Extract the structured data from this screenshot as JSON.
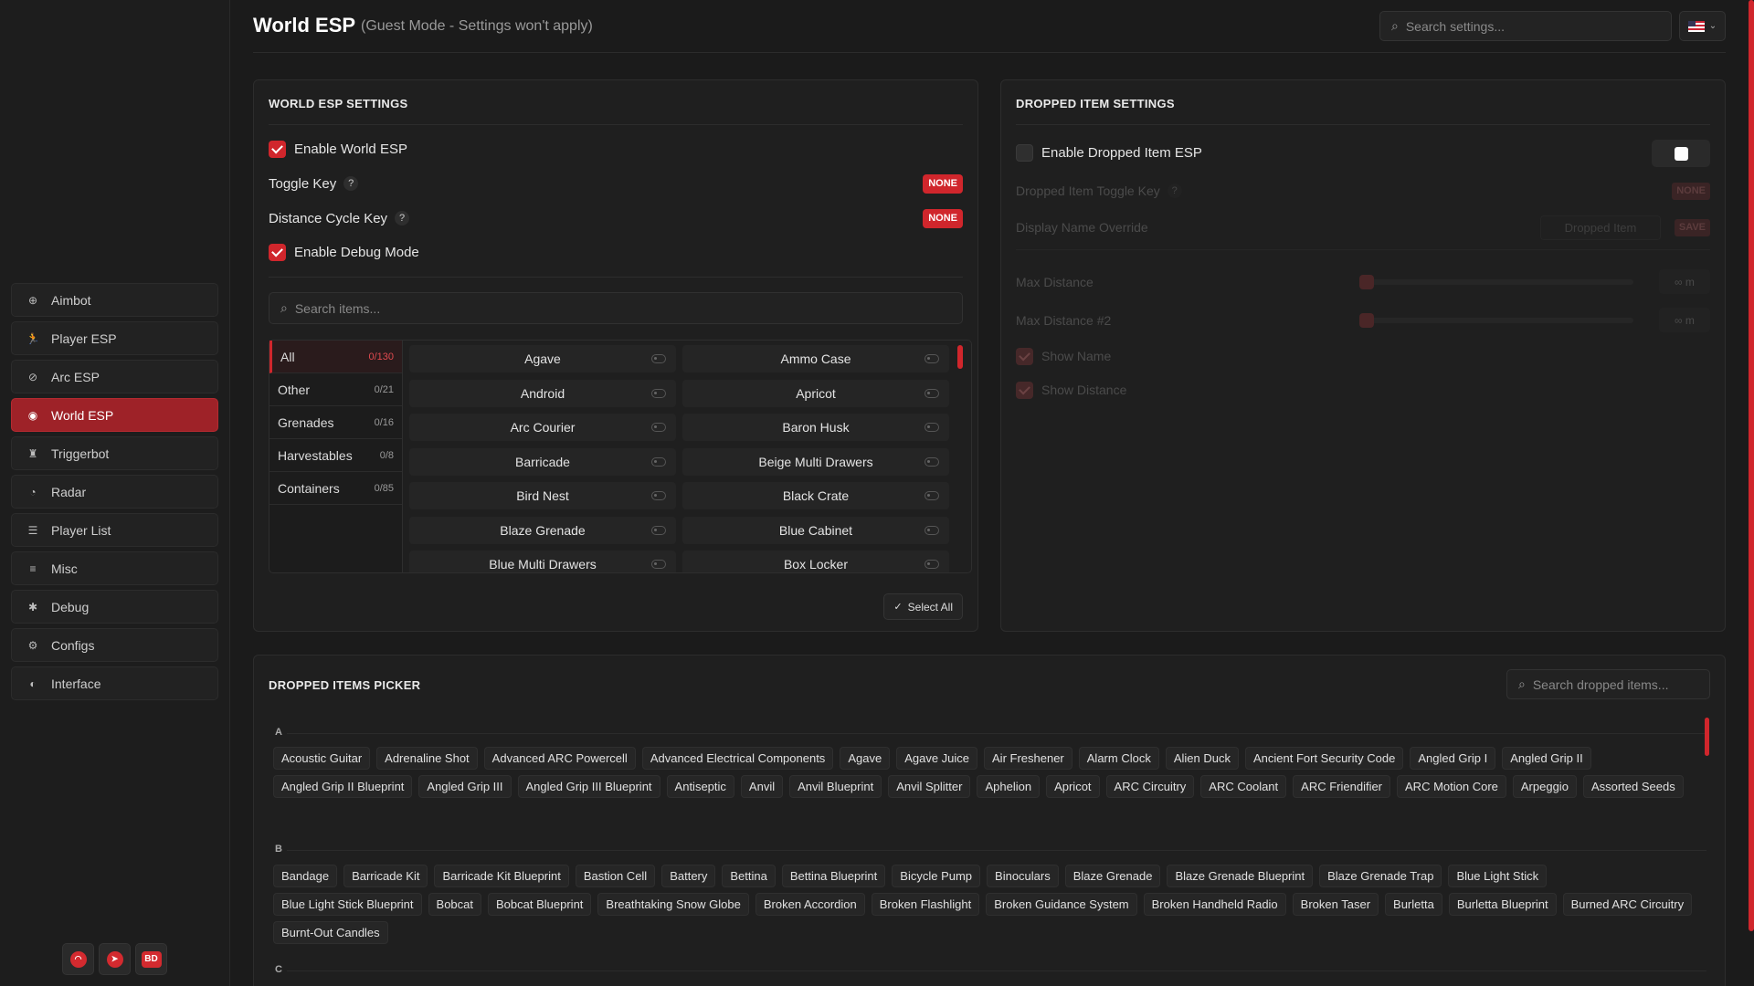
{
  "sidebar": {
    "items": [
      {
        "label": "Aimbot",
        "icon": "crosshair-icon",
        "glyph": "⊕"
      },
      {
        "label": "Player ESP",
        "icon": "running-person-icon",
        "glyph": "🏃"
      },
      {
        "label": "Arc ESP",
        "icon": "eye-slash-icon",
        "glyph": "⊘"
      },
      {
        "label": "World ESP",
        "icon": "globe-icon",
        "glyph": "◉"
      },
      {
        "label": "Triggerbot",
        "icon": "robot-icon",
        "glyph": "♜"
      },
      {
        "label": "Radar",
        "icon": "radar-icon",
        "glyph": "◔"
      },
      {
        "label": "Player List",
        "icon": "list-icon",
        "glyph": "☰"
      },
      {
        "label": "Misc",
        "icon": "menu-icon",
        "glyph": "≡"
      },
      {
        "label": "Debug",
        "icon": "bug-icon",
        "glyph": "✱"
      },
      {
        "label": "Configs",
        "icon": "gear-icon",
        "glyph": "⚙"
      },
      {
        "label": "Interface",
        "icon": "palette-icon",
        "glyph": "◐"
      }
    ],
    "active": "World ESP",
    "social": [
      {
        "icon": "discord-icon",
        "glyph": "◠"
      },
      {
        "icon": "telegram-icon",
        "glyph": "➤"
      },
      {
        "icon": "bd-logo-icon",
        "glyph": "BD"
      }
    ]
  },
  "header": {
    "title": "World ESP",
    "subtitle": "(Guest Mode - Settings won't apply)",
    "search_placeholder": "Search settings..."
  },
  "world_esp": {
    "title": "WORLD ESP SETTINGS",
    "enable_label": "Enable World ESP",
    "toggle_key_label": "Toggle Key",
    "toggle_key_value": "NONE",
    "distance_key_label": "Distance Cycle Key",
    "distance_key_value": "NONE",
    "debug_label": "Enable Debug Mode",
    "search_placeholder": "Search items...",
    "help_glyph": "?",
    "categories": [
      {
        "name": "All",
        "count": "0/130"
      },
      {
        "name": "Other",
        "count": "0/21"
      },
      {
        "name": "Grenades",
        "count": "0/16"
      },
      {
        "name": "Harvestables",
        "count": "0/8"
      },
      {
        "name": "Containers",
        "count": "0/85"
      }
    ],
    "items": [
      "Agave",
      "Ammo Case",
      "Android",
      "Apricot",
      "Arc Courier",
      "Baron Husk",
      "Barricade",
      "Beige Multi Drawers",
      "Bird Nest",
      "Black Crate",
      "Blaze Grenade",
      "Blue Cabinet",
      "Blue Multi Drawers",
      "Box Locker"
    ],
    "select_all_label": "Select All"
  },
  "dropped_settings": {
    "title": "DROPPED ITEM SETTINGS",
    "enable_label": "Enable Dropped Item ESP",
    "toggle_key_label": "Dropped Item Toggle Key",
    "toggle_key_value": "NONE",
    "name_override_label": "Display Name Override",
    "name_override_placeholder": "Dropped Item",
    "save_label": "SAVE",
    "max_distance_label": "Max Distance",
    "max_distance_value": "∞ m",
    "max_distance2_label": "Max Distance #2",
    "max_distance2_value": "∞ m",
    "show_name_label": "Show Name",
    "show_distance_label": "Show Distance"
  },
  "picker": {
    "title": "DROPPED ITEMS PICKER",
    "search_placeholder": "Search dropped items...",
    "groups": [
      {
        "letter": "A",
        "items": [
          "Acoustic Guitar",
          "Adrenaline Shot",
          "Advanced ARC Powercell",
          "Advanced Electrical Components",
          "Agave",
          "Agave Juice",
          "Air Freshener",
          "Alarm Clock",
          "Alien Duck",
          "Ancient Fort Security Code",
          "Angled Grip I",
          "Angled Grip II",
          "Angled Grip II Blueprint",
          "Angled Grip III",
          "Angled Grip III Blueprint",
          "Antiseptic",
          "Anvil",
          "Anvil Blueprint",
          "Anvil Splitter",
          "Aphelion",
          "Apricot",
          "ARC Circuitry",
          "ARC Coolant",
          "ARC Friendifier",
          "ARC Motion Core",
          "Arpeggio",
          "Assorted Seeds"
        ]
      },
      {
        "letter": "B",
        "items": [
          "Bandage",
          "Barricade Kit",
          "Barricade Kit Blueprint",
          "Bastion Cell",
          "Battery",
          "Bettina",
          "Bettina Blueprint",
          "Bicycle Pump",
          "Binoculars",
          "Blaze Grenade",
          "Blaze Grenade Blueprint",
          "Blaze Grenade Trap",
          "Blue Light Stick",
          "Blue Light Stick Blueprint",
          "Bobcat",
          "Bobcat Blueprint",
          "Breathtaking Snow Globe",
          "Broken Accordion",
          "Broken Flashlight",
          "Broken Guidance System",
          "Broken Handheld Radio",
          "Broken Taser",
          "Burletta",
          "Burletta Blueprint",
          "Burned ARC Circuitry",
          "Burnt-Out Candles"
        ]
      },
      {
        "letter": "C",
        "items": []
      }
    ]
  },
  "colors": {
    "accent": "#d0262c",
    "background": "#1b1b1b",
    "panel": "#1f1f1f"
  }
}
